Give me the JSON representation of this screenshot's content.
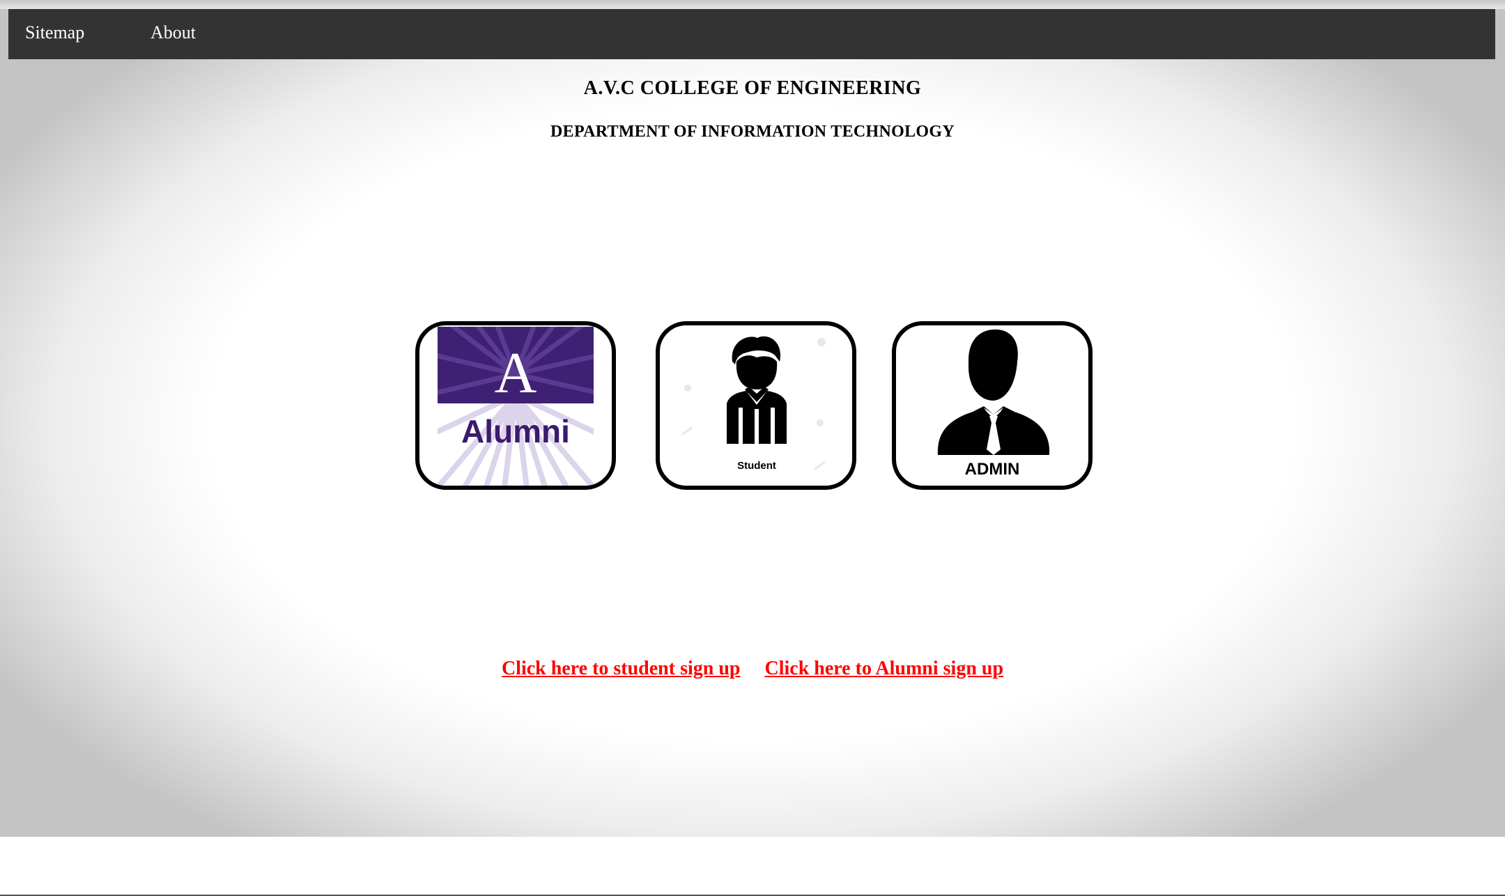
{
  "nav": {
    "sitemap_label": "Sitemap",
    "about_label": "About"
  },
  "header": {
    "college_name": "A.V.C COLLEGE OF ENGINEERING",
    "department": "DEPARTMENT OF INFORMATION TECHNOLOGY"
  },
  "cards": {
    "alumni": {
      "letter": "A",
      "label": "Alumni",
      "icon": "alumni-badge-icon"
    },
    "student": {
      "label": "Student",
      "icon": "student-avatar-icon"
    },
    "admin": {
      "label": "ADMIN",
      "icon": "admin-avatar-icon"
    }
  },
  "signup": {
    "student_link": "Click here to student sign up",
    "alumni_link": "Click here to Alumni sign up"
  },
  "colors": {
    "navbar": "#333333",
    "link": "#ff0000",
    "alumni_purple": "#3f2174",
    "alumni_text": "#3b1a6e"
  }
}
